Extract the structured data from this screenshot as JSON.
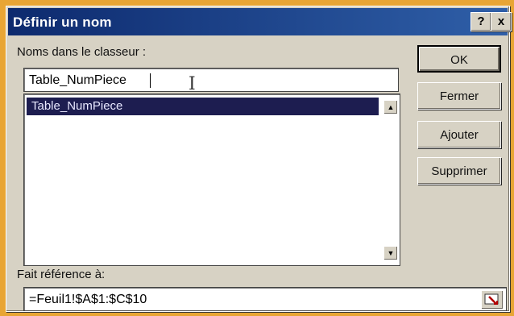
{
  "window": {
    "title": "Définir un nom",
    "help_label": "?",
    "close_label": "x"
  },
  "names": {
    "label": "Noms dans le classeur :",
    "input_value": "Table_NumPiece",
    "list_items": [
      "Table_NumPiece"
    ]
  },
  "buttons": {
    "ok": "OK",
    "close": "Fermer",
    "add": "Ajouter",
    "delete": "Supprimer"
  },
  "reference": {
    "label": "Fait référence à:",
    "value": "=Feuil1!$A$1:$C$10"
  },
  "colors": {
    "titlebar_start": "#0d2a6e",
    "titlebar_end": "#2f5fa8",
    "selection": "#1d1d50",
    "dialog_bg": "#d7d2c4",
    "frame": "#e8a535"
  },
  "icons": {
    "collapse_dialog": "range-select-icon",
    "cursor": "ibeam-cursor-icon"
  }
}
